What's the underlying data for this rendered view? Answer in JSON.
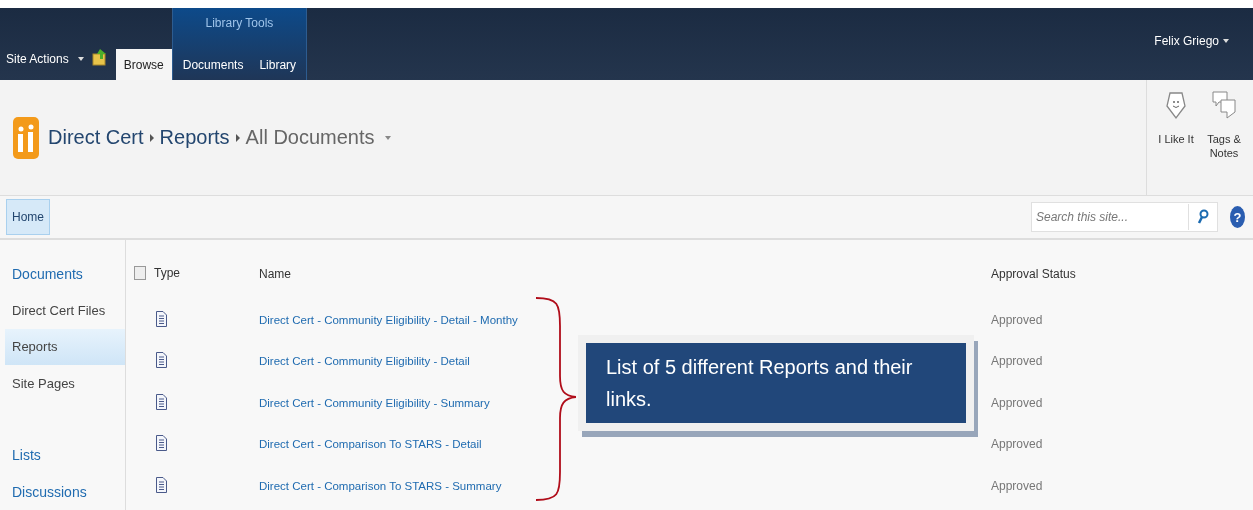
{
  "top_bar": {
    "site_actions": "Site Actions",
    "ribbon_group": "Library Tools",
    "tabs": [
      {
        "label": "Browse",
        "selected": true
      },
      {
        "label": "Documents",
        "selected": false
      },
      {
        "label": "Library",
        "selected": false
      }
    ],
    "user": "Felix Griego"
  },
  "breadcrumb": [
    "Direct Cert",
    "Reports",
    "All Documents"
  ],
  "social": [
    {
      "label": "I Like It",
      "kind": "like"
    },
    {
      "label": "Tags & Notes",
      "kind": "tags"
    }
  ],
  "nav_tabs": [
    {
      "label": "Home",
      "selected": true
    }
  ],
  "search": {
    "placeholder": "Search this site..."
  },
  "help": "?",
  "select_all": {
    "checked": false
  },
  "sidebar": {
    "items": [
      {
        "label": "Documents",
        "kind": "heading",
        "selected": false
      },
      {
        "label": "Direct Cert Files",
        "kind": "link",
        "selected": false
      },
      {
        "label": "Reports",
        "kind": "link",
        "selected": true
      },
      {
        "label": "Site Pages",
        "kind": "link",
        "selected": false
      },
      {
        "label": "Lists",
        "kind": "heading",
        "selected": false
      },
      {
        "label": "Discussions",
        "kind": "heading",
        "selected": false
      }
    ]
  },
  "table": {
    "columns": [
      "Type",
      "Name",
      "Approval Status"
    ],
    "rows": [
      {
        "name": "Direct Cert - Community Eligibility - Detail - Monthy",
        "status": "Approved"
      },
      {
        "name": "Direct Cert - Community Eligibility - Detail",
        "status": "Approved"
      },
      {
        "name": "Direct Cert - Community Eligibility - Summary",
        "status": "Approved"
      },
      {
        "name": "Direct Cert - Comparison To STARS - Detail",
        "status": "Approved"
      },
      {
        "name": "Direct Cert - Comparison To STARS - Summary",
        "status": "Approved"
      }
    ]
  },
  "callout": {
    "text": "List of 5 different Reports and their links."
  }
}
